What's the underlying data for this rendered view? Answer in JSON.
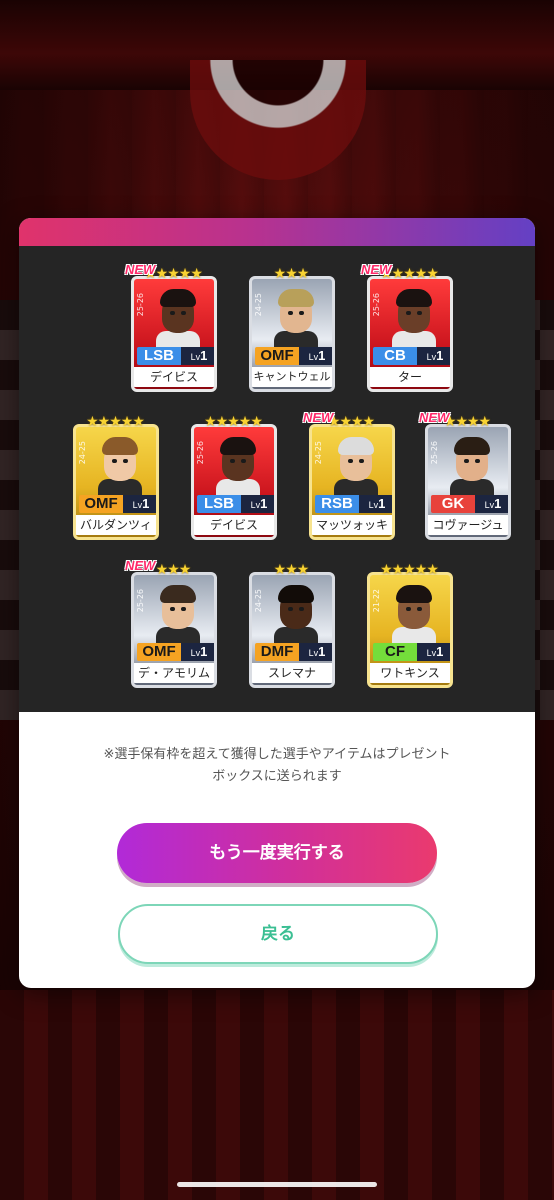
{
  "notice_text": "※選手保有枠を超えて獲得した選手やアイテムはプレゼントボックスに送られます",
  "buttons": {
    "retry_label": "もう一度実行する",
    "back_label": "戻る"
  },
  "new_label": "NEW",
  "level_prefix": "Lv",
  "cards": [
    {
      "name": "デイビス",
      "position": "LSB",
      "level": "1",
      "season": "25-26",
      "rarity": "red",
      "stars": 5,
      "is_new": true
    },
    {
      "name": "キャントウェル",
      "position": "OMF",
      "level": "1",
      "season": "24-25",
      "rarity": "silver",
      "stars": 3,
      "is_new": false
    },
    {
      "name": "ター",
      "position": "CB",
      "level": "1",
      "season": "25-26",
      "rarity": "red",
      "stars": 5,
      "is_new": true
    },
    {
      "name": "バルダンツィ",
      "position": "OMF",
      "level": "1",
      "season": "24-25",
      "rarity": "gold",
      "stars": 5,
      "is_new": false
    },
    {
      "name": "デイビス",
      "position": "LSB",
      "level": "1",
      "season": "25-26",
      "rarity": "red",
      "stars": 5,
      "is_new": false
    },
    {
      "name": "マッツォッキ",
      "position": "RSB",
      "level": "1",
      "season": "24-25",
      "rarity": "gold",
      "stars": 4,
      "is_new": true
    },
    {
      "name": "コヴァージュ",
      "position": "GK",
      "level": "1",
      "season": "25-26",
      "rarity": "silver",
      "stars": 4,
      "is_new": true
    },
    {
      "name": "デ・アモリム",
      "position": "OMF",
      "level": "1",
      "season": "25-26",
      "rarity": "silver",
      "stars": 3,
      "is_new": true
    },
    {
      "name": "スレマナ",
      "position": "DMF",
      "level": "1",
      "season": "24-25",
      "rarity": "silver",
      "stars": 3,
      "is_new": false
    },
    {
      "name": "ワトキンス",
      "position": "CF",
      "level": "1",
      "season": "21-22",
      "rarity": "gold",
      "stars": 5,
      "is_new": false
    }
  ]
}
